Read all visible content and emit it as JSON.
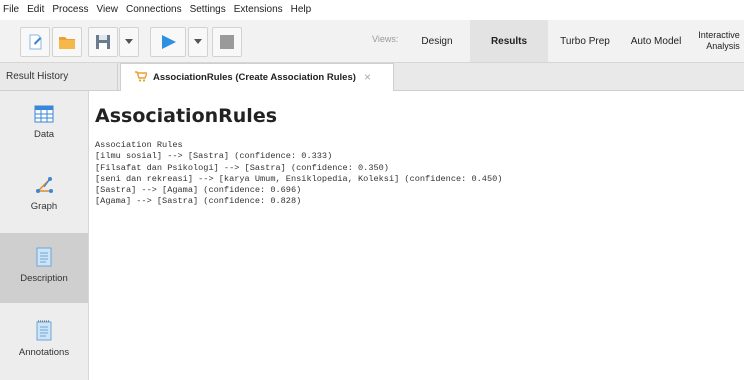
{
  "menu": [
    "File",
    "Edit",
    "Process",
    "View",
    "Connections",
    "Settings",
    "Extensions",
    "Help"
  ],
  "toolbar": {
    "icons": [
      "new-process-icon",
      "open-folder-icon",
      "save-icon",
      "dropdown-icon",
      "run-icon",
      "dropdown-icon",
      "stop-icon"
    ],
    "views_label": "Views:",
    "views": [
      "Design",
      "Results",
      "Turbo Prep",
      "Auto Model"
    ],
    "interactive_line1": "Interactive",
    "interactive_line2": "Analysis",
    "active_view": "Results"
  },
  "tabs": {
    "history": "Result History",
    "active": "AssociationRules (Create Association Rules)",
    "close": "×"
  },
  "sidebar": {
    "items": [
      "Data",
      "Graph",
      "Description",
      "Annotations"
    ],
    "active": "Description"
  },
  "content": {
    "title": "AssociationRules",
    "heading": "Association Rules",
    "rules": [
      "[ilmu sosial] --> [Sastra] (confidence: 0.333)",
      "[Filsafat dan Psikologi] --> [Sastra] (confidence: 0.350)",
      "[seni dan rekreasi] --> [karya Umum, Ensiklopedia, Koleksi] (confidence: 0.450)",
      "[Sastra] --> [Agama] (confidence: 0.696)",
      "[Agama] --> [Sastra] (confidence: 0.828)"
    ]
  },
  "colors": {
    "run_blue": "#2f8fe0",
    "folder_orange": "#f0a030",
    "table_blue": "#3a86d8"
  }
}
